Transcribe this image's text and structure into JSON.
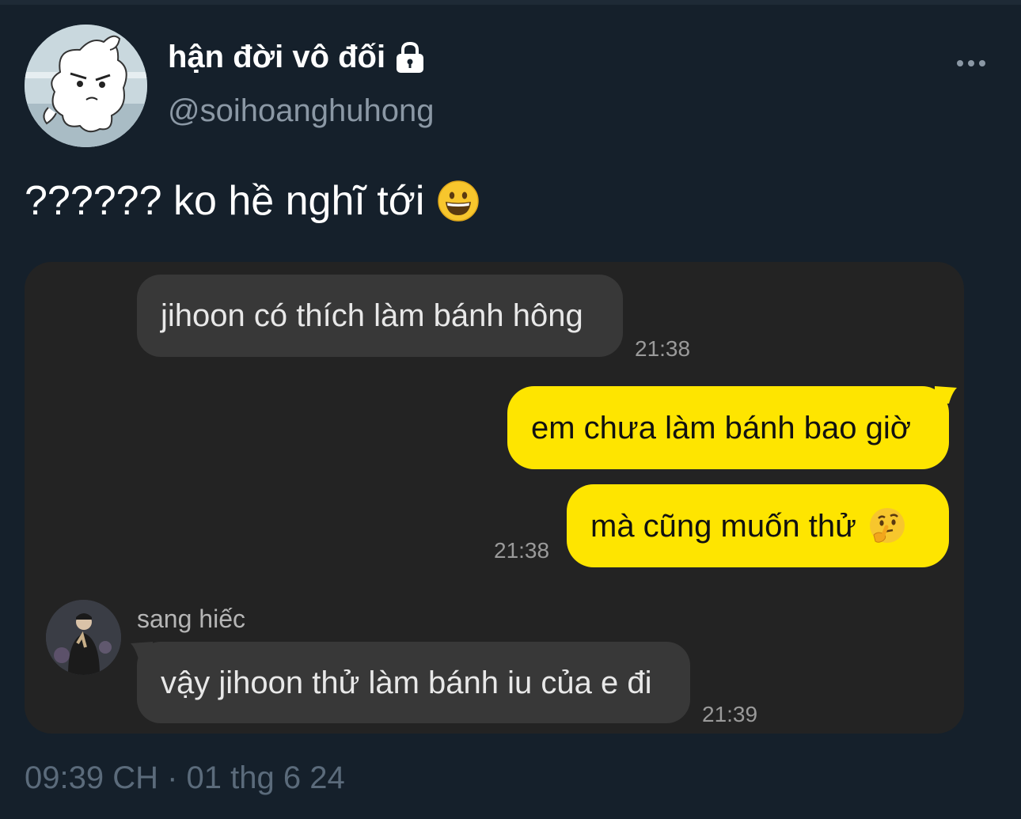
{
  "tweet": {
    "author": {
      "display_name": "hận đời vô đối",
      "handle": "@soihoanghuhong",
      "avatar_icon": "dog-cartoon-avatar",
      "lock_icon": "lock-icon"
    },
    "more_icon": "more-options-icon",
    "text": "?????? ko hề nghĩ tới",
    "text_emoji": "grinning-face-emoji",
    "timestamp": "09:39 CH · 01 thg 6 24"
  },
  "chat_screenshot": {
    "messages": [
      {
        "side": "left",
        "text": "jihoon có thích làm bánh hông",
        "time": "21:38"
      },
      {
        "side": "right",
        "text": "em chưa làm bánh bao giờ"
      },
      {
        "side": "right",
        "text": "mà cũng muốn thử",
        "emoji": "thinking-face-emoji",
        "time": "21:38"
      },
      {
        "side": "left",
        "sender": "sang hiếc",
        "text": "vậy jihoon thử làm bánh iu của e đi",
        "time": "21:39"
      }
    ],
    "colors": {
      "background": "#232323",
      "incoming_bubble": "#383838",
      "outgoing_bubble": "#fee500"
    }
  },
  "colors": {
    "page_background": "#15202b",
    "secondary_text": "#8b98a5",
    "timestamp_text": "#5b6b7b"
  }
}
